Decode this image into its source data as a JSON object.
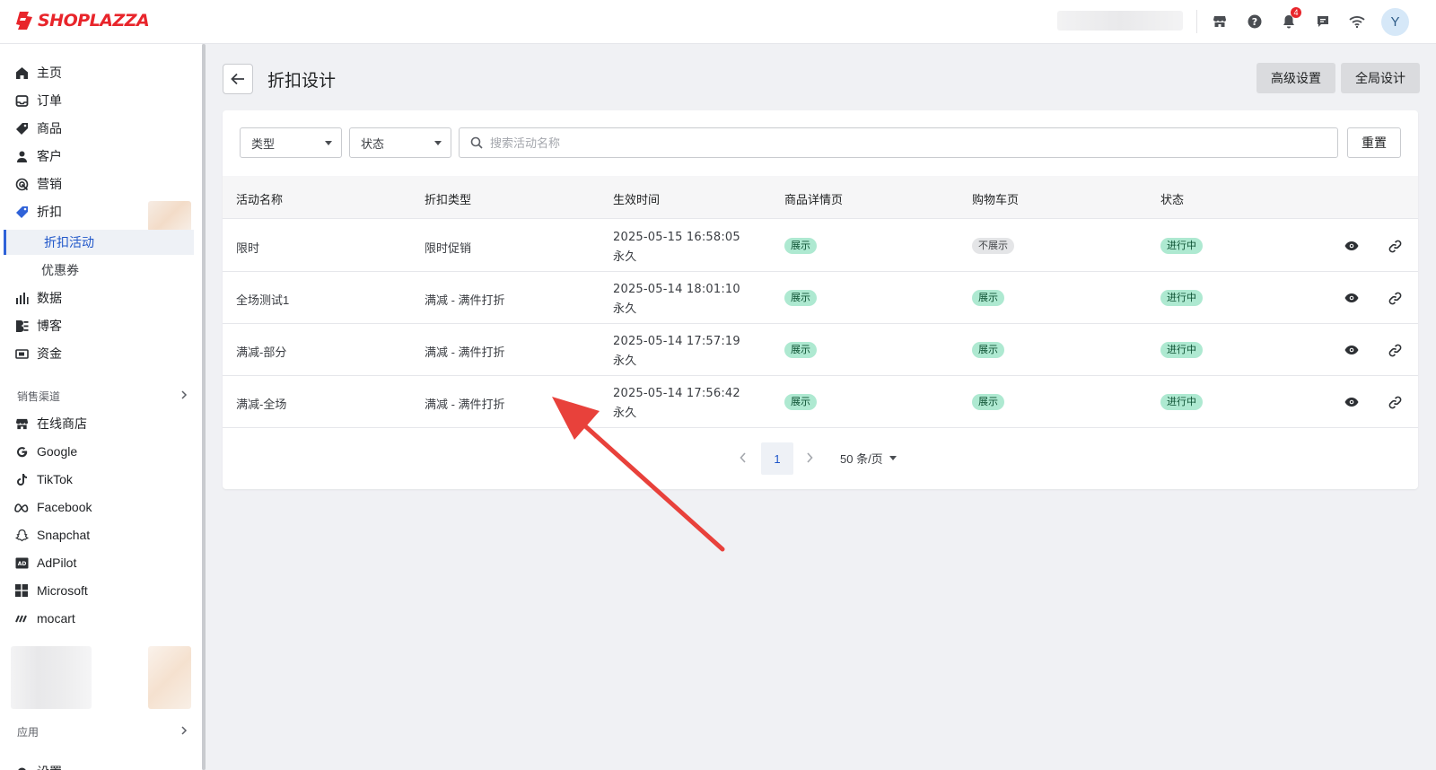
{
  "brand": {
    "logo_text": "SHOPLAZZA",
    "color": "#e8252b"
  },
  "topbar": {
    "icons": [
      "store-icon",
      "help-icon",
      "bell-icon",
      "chat-icon",
      "wifi-icon"
    ],
    "notification_count": "4",
    "avatar_initial": "Y"
  },
  "sidebar": {
    "items": [
      {
        "label": "主页",
        "icon": "home-icon"
      },
      {
        "label": "订单",
        "icon": "inbox-icon"
      },
      {
        "label": "商品",
        "icon": "tag-icon"
      },
      {
        "label": "客户",
        "icon": "person-icon"
      },
      {
        "label": "营销",
        "icon": "target-icon"
      },
      {
        "label": "折扣",
        "icon": "discount-icon"
      }
    ],
    "discount_sub": [
      {
        "label": "折扣活动",
        "active": true
      },
      {
        "label": "优惠券",
        "active": false
      }
    ],
    "items2": [
      {
        "label": "数据",
        "icon": "bar-chart-icon"
      },
      {
        "label": "博客",
        "icon": "blog-icon"
      },
      {
        "label": "资金",
        "icon": "wallet-icon"
      }
    ],
    "sales_channels_title": "销售渠道",
    "channels": [
      {
        "label": "在线商店",
        "icon": "store-icon"
      },
      {
        "label": "Google",
        "icon": "google-icon"
      },
      {
        "label": "TikTok",
        "icon": "tiktok-icon"
      },
      {
        "label": "Facebook",
        "icon": "meta-icon"
      },
      {
        "label": "Snapchat",
        "icon": "snapchat-icon"
      },
      {
        "label": "AdPilot",
        "icon": "ad-icon"
      },
      {
        "label": "Microsoft",
        "icon": "microsoft-icon"
      },
      {
        "label": "mocart",
        "icon": "mocart-icon"
      }
    ],
    "apps_title": "应用",
    "settings_label": "设置"
  },
  "page": {
    "title": "折扣设计",
    "buttons": {
      "advanced": "高级设置",
      "global": "全局设计"
    }
  },
  "filters": {
    "type_label": "类型",
    "status_label": "状态",
    "search_placeholder": "搜索活动名称",
    "reset": "重置"
  },
  "table": {
    "columns": [
      "活动名称",
      "折扣类型",
      "生效时间",
      "商品详情页",
      "购物车页",
      "状态"
    ],
    "rows": [
      {
        "name": "限时",
        "type": "限时促销",
        "start": "2025-05-15 16:58:05",
        "end": "永久",
        "pdp": "展示",
        "pdp_on": true,
        "cart": "不展示",
        "cart_on": false,
        "status": "进行中"
      },
      {
        "name": "全场测试1",
        "type": "满减 - 满件打折",
        "start": "2025-05-14 18:01:10",
        "end": "永久",
        "pdp": "展示",
        "pdp_on": true,
        "cart": "展示",
        "cart_on": true,
        "status": "进行中"
      },
      {
        "name": "满减-部分",
        "type": "满减 - 满件打折",
        "start": "2025-05-14 17:57:19",
        "end": "永久",
        "pdp": "展示",
        "pdp_on": true,
        "cart": "展示",
        "cart_on": true,
        "status": "进行中"
      },
      {
        "name": "满减-全场",
        "type": "满减 - 满件打折",
        "start": "2025-05-14 17:56:42",
        "end": "永久",
        "pdp": "展示",
        "pdp_on": true,
        "cart": "展示",
        "cart_on": true,
        "status": "进行中"
      }
    ]
  },
  "pagination": {
    "current_page": "1",
    "page_size": "50 条/页"
  },
  "annotation": {
    "arrow_color": "#e8413b"
  }
}
